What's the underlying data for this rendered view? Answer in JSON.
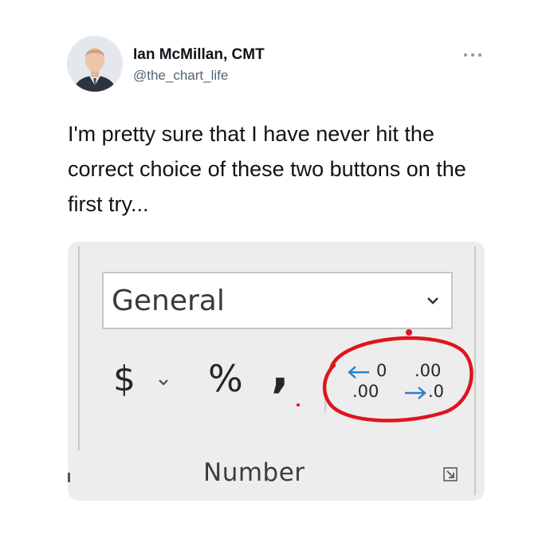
{
  "tweet": {
    "author_name": "Ian McMillan, CMT",
    "author_handle": "@the_chart_life",
    "text": "I'm pretty sure that I have never hit the correct choice of these two buttons on the first try..."
  },
  "ribbon": {
    "number_format_value": "General",
    "currency_symbol": "$",
    "percent_symbol": "%",
    "comma_symbol": ",",
    "increase_decimal": {
      "top": "0",
      "bottom": ".00"
    },
    "decrease_decimal": {
      "top": ".00",
      "bottom": ".0"
    },
    "group_label": "Number",
    "accent_color": "#2e7fc8",
    "annotation_color": "#e0141e"
  },
  "icons": [
    "more-icon",
    "chevron-down-icon",
    "increase-decimal-icon",
    "decrease-decimal-icon",
    "dialog-launcher-icon"
  ]
}
